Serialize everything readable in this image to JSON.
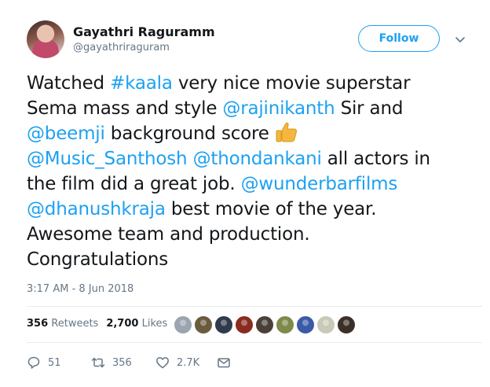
{
  "author": {
    "name": "Gayathri Raguramm",
    "handle": "@gayathriraguram"
  },
  "follow_button": {
    "label": "Follow",
    "color": "#1da1f2"
  },
  "tweet": {
    "lines": [
      [
        {
          "t": "Watched "
        },
        {
          "t": "#kaala",
          "link": true
        },
        {
          "t": " very nice movie superstar"
        }
      ],
      [
        {
          "t": "Sema mass and style "
        },
        {
          "t": "@rajinikanth",
          "link": true
        },
        {
          "t": " Sir and"
        }
      ],
      [
        {
          "t": "@beemji",
          "link": true
        },
        {
          "t": " background score "
        },
        {
          "emoji": "thumbs-up-emoji"
        }
      ],
      [
        {
          "t": "@Music_Santhosh",
          "link": true
        },
        {
          "t": " "
        },
        {
          "t": "@thondankani",
          "link": true
        },
        {
          "t": " all actors in"
        }
      ],
      [
        {
          "t": "the film did a great job. "
        },
        {
          "t": "@wunderbarfilms",
          "link": true
        }
      ],
      [
        {
          "t": "@dhanushkraja",
          "link": true
        },
        {
          "t": " best movie of the year."
        }
      ],
      [
        {
          "t": "Awesome team and production."
        }
      ],
      [
        {
          "t": "Congratulations"
        }
      ]
    ]
  },
  "timestamp": "3:17 AM - 8 Jun 2018",
  "stats": {
    "retweets_count": "356",
    "retweets_label": "Retweets",
    "likes_count": "2,700",
    "likes_label": "Likes"
  },
  "likers": [
    {
      "name": "liker-avatar-1",
      "color": "#9aa5b1"
    },
    {
      "name": "liker-avatar-2",
      "color": "#6b5a3e"
    },
    {
      "name": "liker-avatar-3",
      "color": "#2f3b4c"
    },
    {
      "name": "liker-avatar-4",
      "color": "#8a2b1f"
    },
    {
      "name": "liker-avatar-5",
      "color": "#4a4038"
    },
    {
      "name": "liker-avatar-6",
      "color": "#7d8a4a"
    },
    {
      "name": "liker-avatar-7",
      "color": "#3b5aa8"
    },
    {
      "name": "liker-avatar-8",
      "color": "#c9c9b8"
    },
    {
      "name": "liker-avatar-9",
      "color": "#3c2f28"
    }
  ],
  "actions": {
    "reply": {
      "icon": "reply-icon",
      "count": "51"
    },
    "retweet": {
      "icon": "retweet-icon",
      "count": "356"
    },
    "like": {
      "icon": "heart-icon",
      "count": "2.7K"
    },
    "message": {
      "icon": "envelope-icon"
    }
  }
}
